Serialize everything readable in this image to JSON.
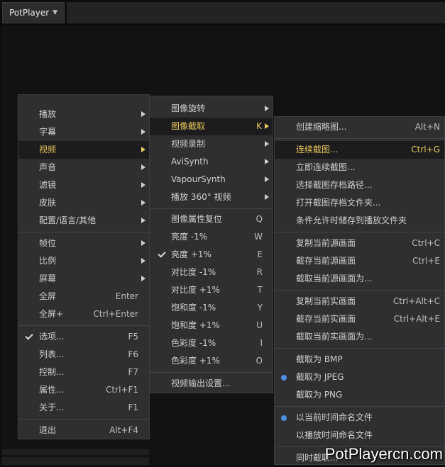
{
  "app": {
    "title": "PotPlayer"
  },
  "menu1": {
    "items": [
      "播放",
      "字幕",
      "视频",
      "声音",
      "滤镜",
      "皮肤",
      "配置/语言/其他",
      "帧位",
      "比例",
      "屏幕",
      "全屏",
      "全屏+",
      "选项...",
      "列表...",
      "控制...",
      "属性...",
      "关于...",
      "退出"
    ],
    "shortcuts": {
      "fullscreen": "Enter",
      "fullscreen_plus": "Ctrl+Enter",
      "options": "F5",
      "list": "F6",
      "control": "F7",
      "properties": "Ctrl+F1",
      "about": "F1",
      "exit": "Alt+F4"
    }
  },
  "menu2": {
    "items": [
      "图像旋转",
      "图像截取",
      "视频录制",
      "AviSynth",
      "VapourSynth",
      "播放 360° 视频",
      "图像属性复位",
      "亮度 -1%",
      "亮度 +1%",
      "对比度 -1%",
      "对比度 +1%",
      "饱和度 -1%",
      "饱和度 +1%",
      "色彩度 -1%",
      "色彩度 +1%",
      "视频输出设置..."
    ],
    "shortcuts": {
      "capture": "K",
      "reset": "Q",
      "bright_down": "W",
      "bright_up": "E",
      "contrast_down": "R",
      "contrast_up": "T",
      "sat_down": "Y",
      "sat_up": "U",
      "hue_down": "I",
      "hue_up": "O"
    }
  },
  "menu3": {
    "items": [
      "创建缩略图...",
      "连续截图...",
      "立即连续截图...",
      "选择截图存档路径...",
      "打开截图存档文件夹...",
      "条件允许时储存到播放文件夹",
      "复制当前源画面",
      "截存当前源画面",
      "截取当前源画面为...",
      "复制当前实画面",
      "截存当前实画面",
      "截取当前实画面为...",
      "截取为 BMP",
      "截取为 JPEG",
      "截取为 PNG",
      "以当前时间命名文件",
      "以播放时间命名文件",
      "同时截取..."
    ],
    "shortcuts": {
      "thumbs": "Alt+N",
      "continuous": "Ctrl+G",
      "copy_src": "Ctrl+C",
      "save_src": "Ctrl+E",
      "copy_real": "Ctrl+Alt+C",
      "save_real": "Ctrl+Alt+E"
    }
  },
  "watermark": "PotPlayercn.com",
  "colors": {
    "highlight_text": "#e8c85c",
    "menu_bg": "#2f2f32",
    "radio_dot": "#4a8fe0"
  }
}
